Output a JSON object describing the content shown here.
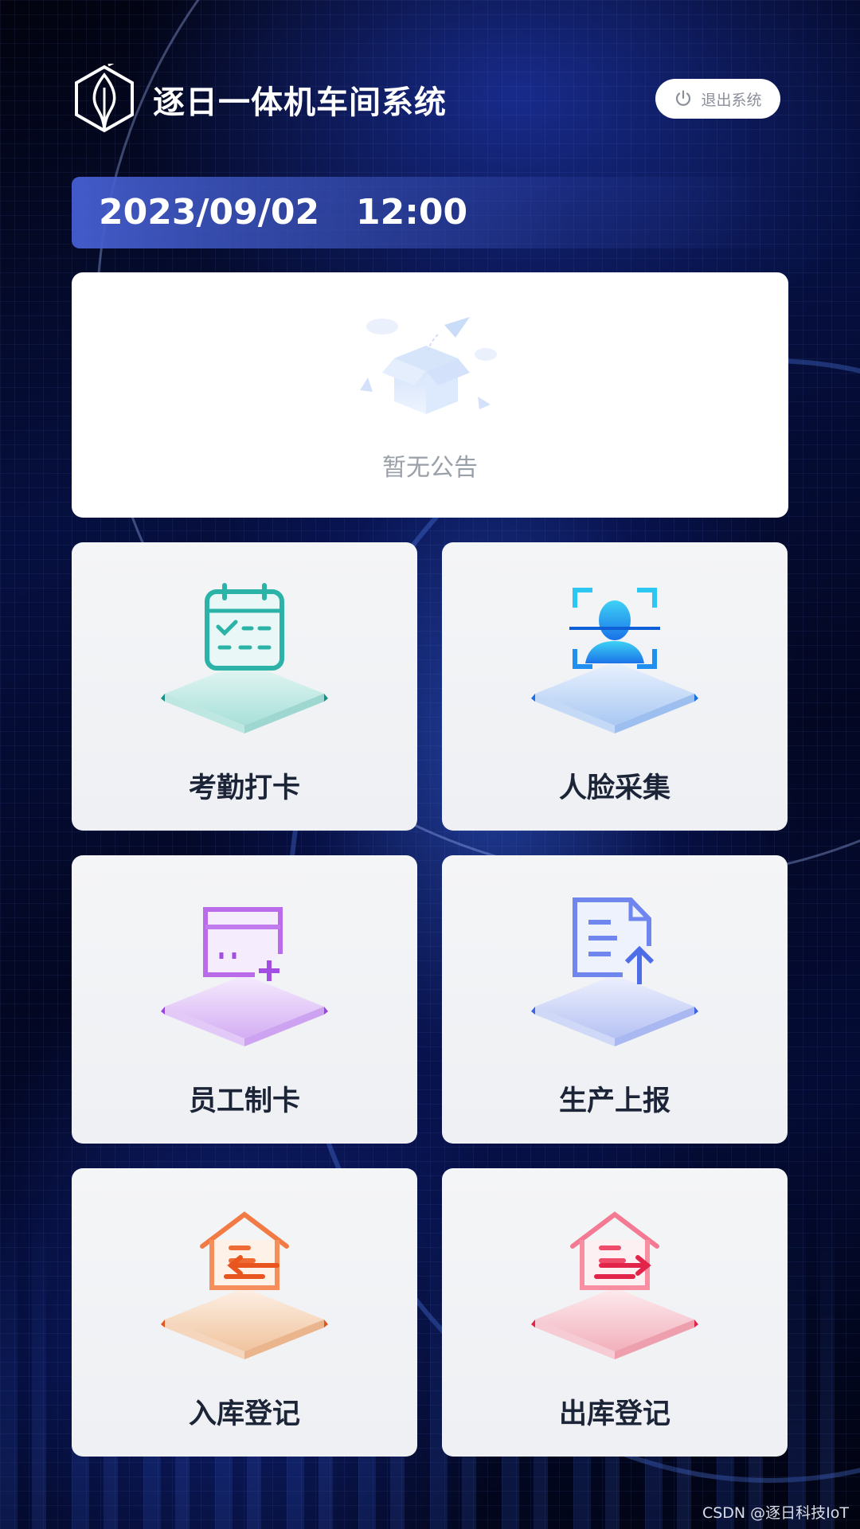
{
  "header": {
    "app_title": "逐日一体机车间系统",
    "logout_label": "退出系统"
  },
  "datetime": {
    "date": "2023/09/02",
    "time": "12:00"
  },
  "notice": {
    "empty_text": "暂无公告"
  },
  "tiles": [
    {
      "label": "考勤打卡",
      "icon": "attendance-calendar-icon",
      "color": "#2bb3a8"
    },
    {
      "label": "人脸采集",
      "icon": "face-scan-icon",
      "color": "#1f8ff0"
    },
    {
      "label": "员工制卡",
      "icon": "card-add-icon",
      "color": "#a855e8"
    },
    {
      "label": "生产上报",
      "icon": "report-upload-icon",
      "color": "#4f6ff0"
    },
    {
      "label": "入库登记",
      "icon": "warehouse-in-icon",
      "color": "#f06a3a"
    },
    {
      "label": "出库登记",
      "icon": "warehouse-out-icon",
      "color": "#ee3e5e"
    }
  ],
  "watermark": "CSDN @逐日科技IoT",
  "colors": {
    "background": "#040c35",
    "card": "#f2f3f5",
    "title_text": "#1c2438",
    "accent_bar": "#465fd2"
  }
}
